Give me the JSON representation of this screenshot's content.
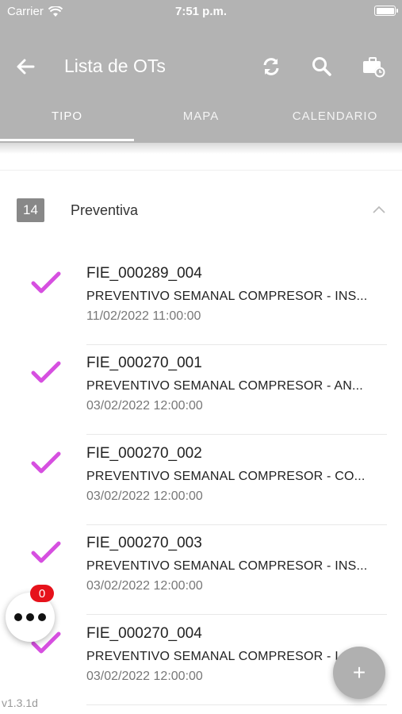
{
  "status": {
    "carrier": "Carrier",
    "time": "7:51 p.m."
  },
  "appbar": {
    "title": "Lista de OTs"
  },
  "tabs": [
    {
      "label": "TIPO"
    },
    {
      "label": "MAPA"
    },
    {
      "label": "CALENDARIO"
    }
  ],
  "group": {
    "count": "14",
    "title": "Preventiva"
  },
  "items": [
    {
      "code": "FIE_000289_004",
      "description": "PREVENTIVO SEMANAL COMPRESOR - INS...",
      "date": "11/02/2022 11:00:00"
    },
    {
      "code": "FIE_000270_001",
      "description": "PREVENTIVO SEMANAL COMPRESOR - AN...",
      "date": "03/02/2022 12:00:00"
    },
    {
      "code": "FIE_000270_002",
      "description": "PREVENTIVO SEMANAL COMPRESOR - CO...",
      "date": "03/02/2022 12:00:00"
    },
    {
      "code": "FIE_000270_003",
      "description": "PREVENTIVO SEMANAL COMPRESOR - INS...",
      "date": "03/02/2022 12:00:00"
    },
    {
      "code": "FIE_000270_004",
      "description": "PREVENTIVO SEMANAL COMPRESOR - I...",
      "date": "03/02/2022 12:00:00"
    }
  ],
  "menu": {
    "badge": "0"
  },
  "fab": {
    "label": "+"
  },
  "version": "v1.3.1d",
  "colors": {
    "header": "#b3b3b3",
    "check": "#d64fe0",
    "badge": "#e6121b"
  }
}
